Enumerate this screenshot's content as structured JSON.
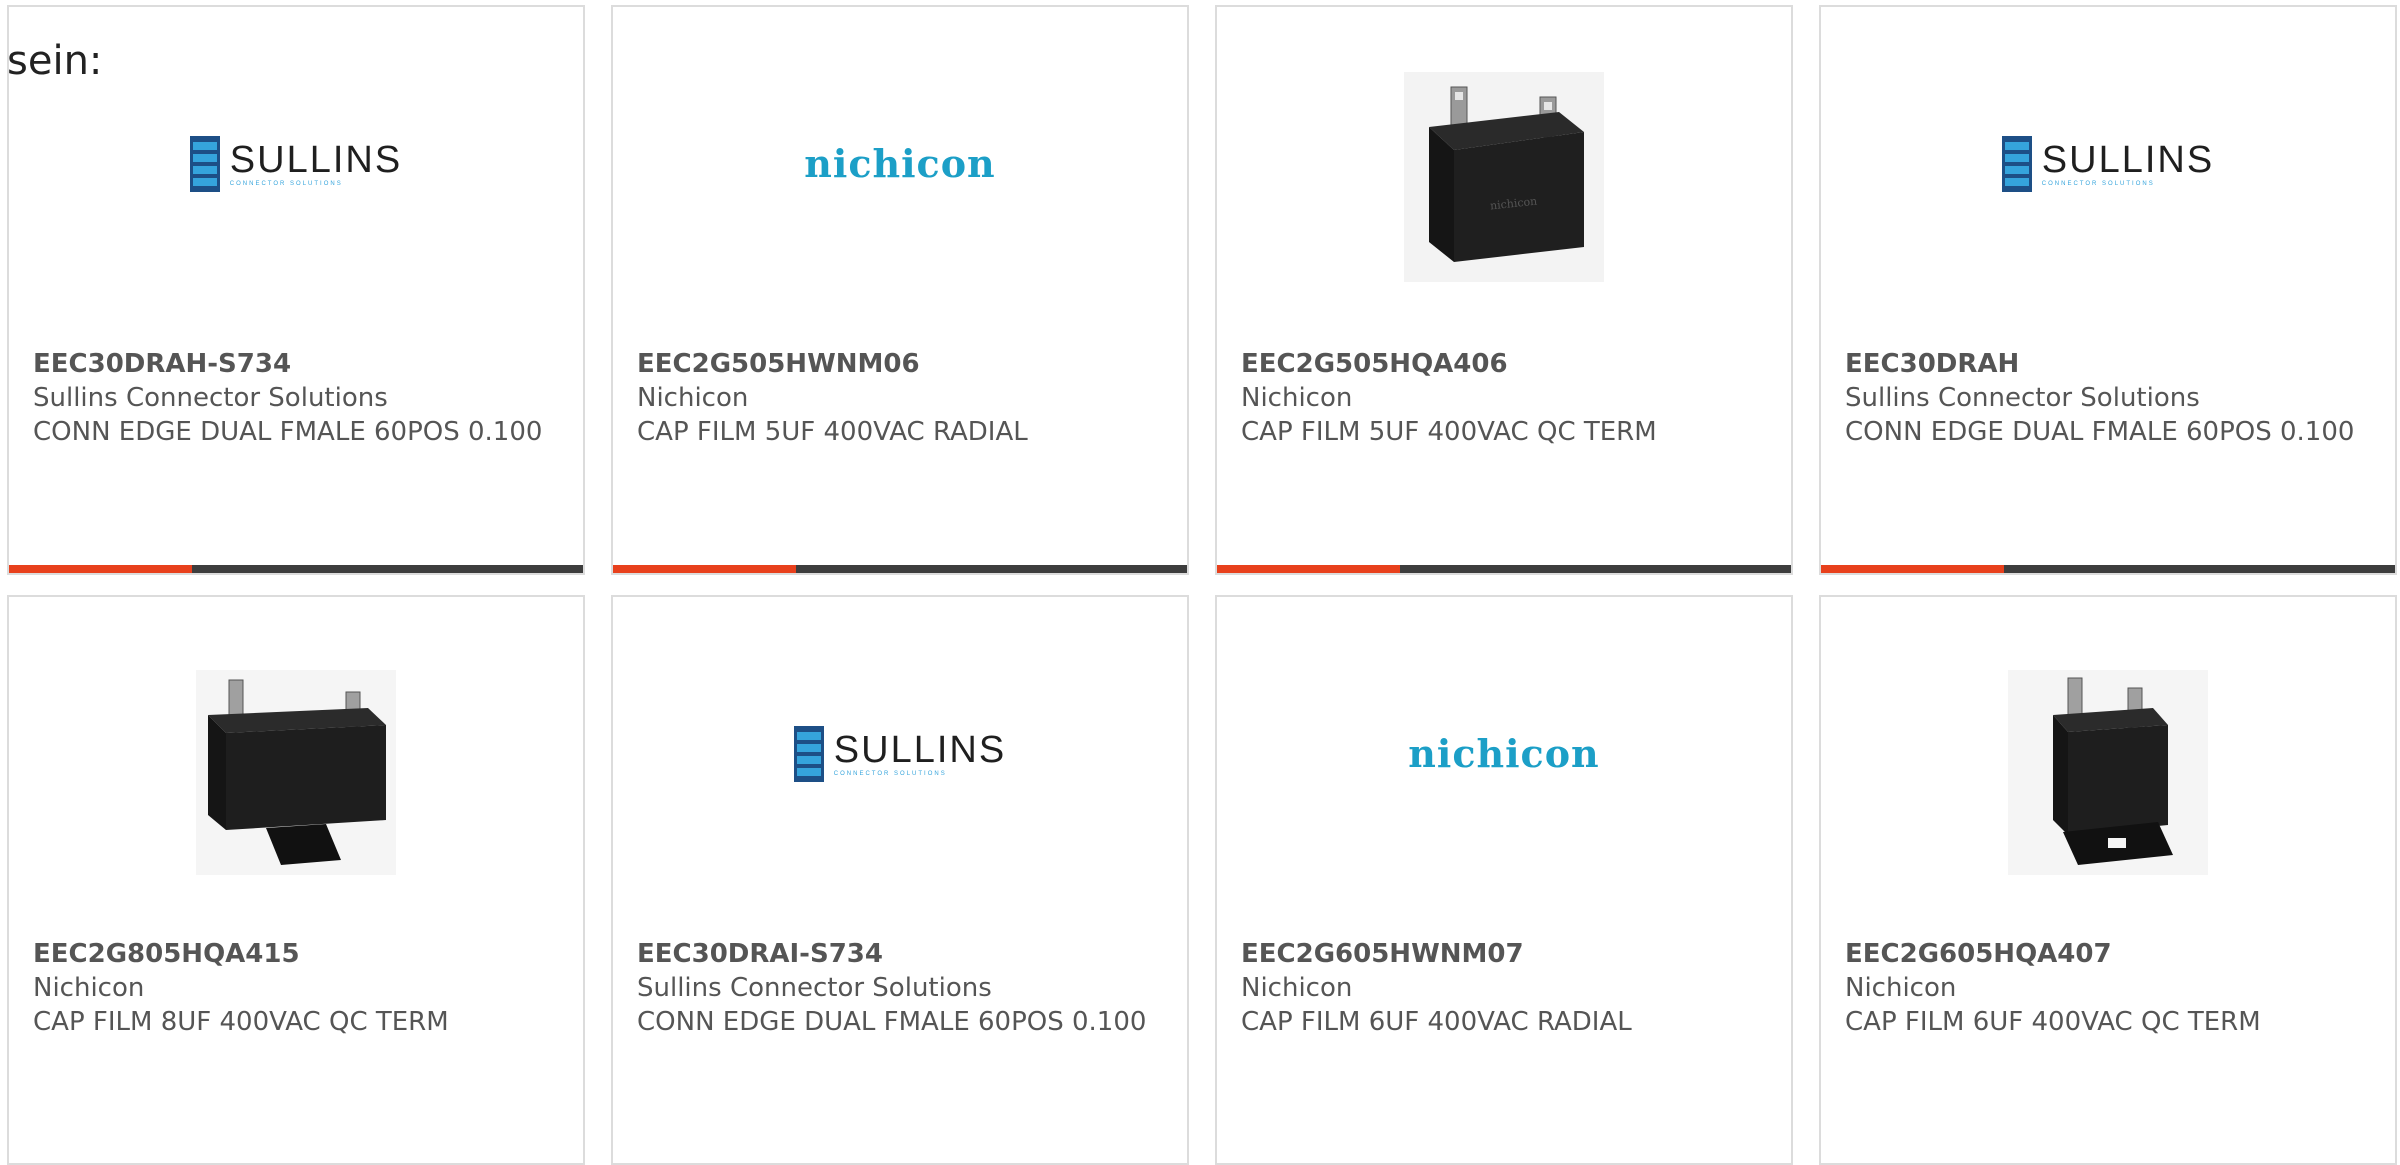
{
  "page": {
    "lead_text": "sein:"
  },
  "colors": {
    "accent": "#e8401c",
    "bar": "#3d3d3d",
    "border": "#dcdcdc",
    "sullins_blue": "#1d4f86",
    "sullins_light": "#35a4dc",
    "nichicon_teal": "#1c9fc7"
  },
  "products": [
    {
      "part_number": "EEC30DRAH-S734",
      "manufacturer": "Sullins Connector Solutions",
      "description": "CONN EDGE DUAL FMALE 60POS 0.100",
      "image": "sullins-logo",
      "logo_text": "SULLINS",
      "logo_subtext": "CONNECTOR SOLUTIONS"
    },
    {
      "part_number": "EEC2G505HWNM06",
      "manufacturer": "Nichicon",
      "description": "CAP FILM 5UF 400VAC RADIAL",
      "image": "nichicon-logo",
      "logo_text": "nichicon"
    },
    {
      "part_number": "EEC2G505HQA406",
      "manufacturer": "Nichicon",
      "description": "CAP FILM 5UF 400VAC QC TERM",
      "image": "capacitor-photo-square"
    },
    {
      "part_number": "EEC30DRAH",
      "manufacturer": "Sullins Connector Solutions",
      "description": "CONN EDGE DUAL FMALE 60POS 0.100",
      "image": "sullins-logo",
      "logo_text": "SULLINS",
      "logo_subtext": "CONNECTOR SOLUTIONS"
    },
    {
      "part_number": "EEC2G805HQA415",
      "manufacturer": "Nichicon",
      "description": "CAP FILM 8UF 400VAC QC TERM",
      "image": "capacitor-photo-flange"
    },
    {
      "part_number": "EEC30DRAI-S734",
      "manufacturer": "Sullins Connector Solutions",
      "description": "CONN EDGE DUAL FMALE 60POS 0.100",
      "image": "sullins-logo",
      "logo_text": "SULLINS",
      "logo_subtext": "CONNECTOR SOLUTIONS"
    },
    {
      "part_number": "EEC2G605HWNM07",
      "manufacturer": "Nichicon",
      "description": "CAP FILM 6UF 400VAC RADIAL",
      "image": "nichicon-logo",
      "logo_text": "nichicon"
    },
    {
      "part_number": "EEC2G605HQA407",
      "manufacturer": "Nichicon",
      "description": "CAP FILM 6UF 400VAC QC TERM",
      "image": "capacitor-photo-tall"
    }
  ]
}
